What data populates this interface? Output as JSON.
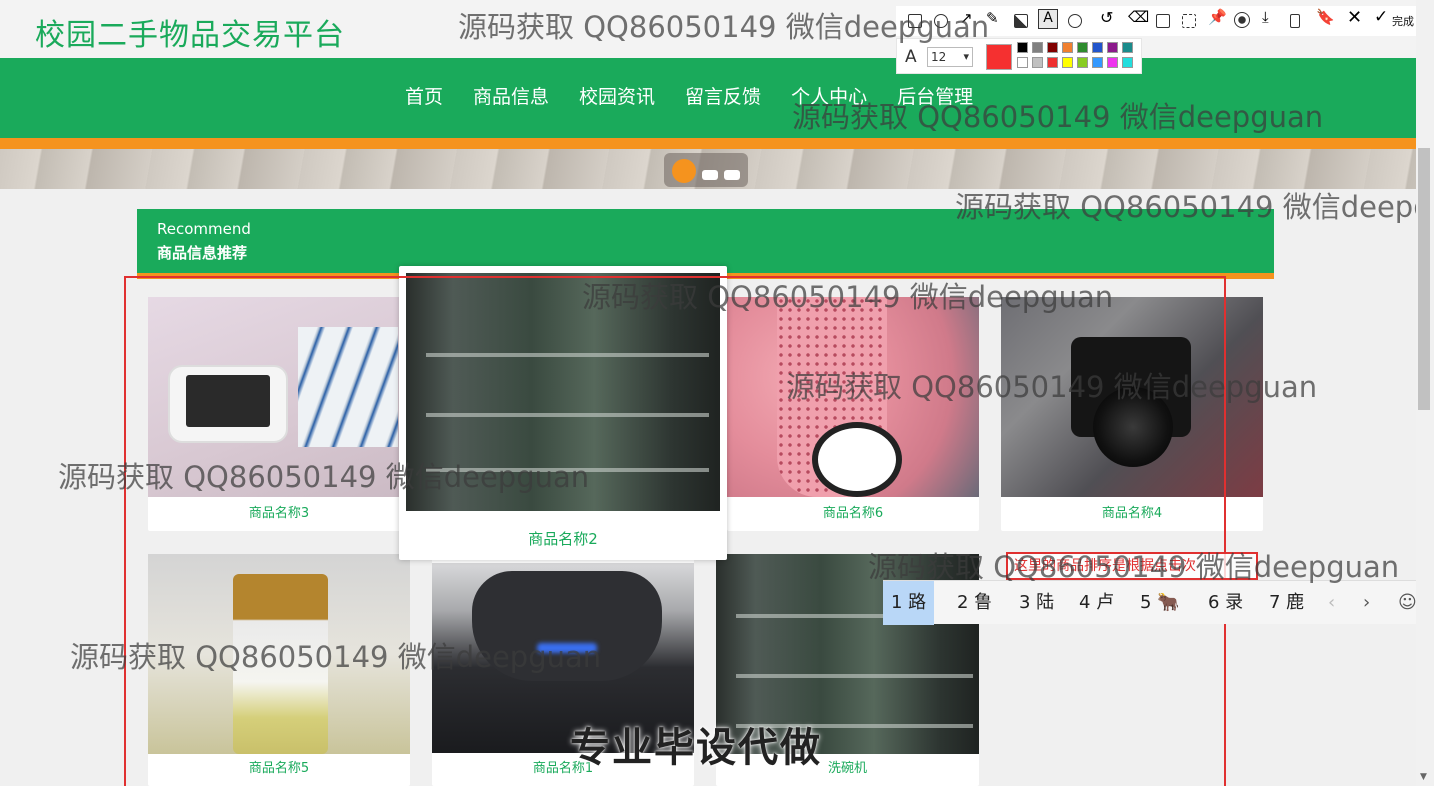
{
  "site": {
    "title": "校园二手物品交易平台"
  },
  "nav": {
    "items": [
      "首页",
      "商品信息",
      "校园资讯",
      "留言反馈",
      "个人中心",
      "后台管理"
    ]
  },
  "recommend": {
    "en": "Recommend",
    "cn": "商品信息推荐"
  },
  "products": [
    {
      "name": "商品名称3"
    },
    {
      "name": "商品名称2"
    },
    {
      "name": "商品名称6"
    },
    {
      "name": "商品名称4"
    },
    {
      "name": "商品名称5"
    },
    {
      "name": "商品名称1"
    },
    {
      "name": "洗碗机"
    }
  ],
  "annotation": {
    "text": "这里的商品排序是根据点击次"
  },
  "toolbar": {
    "done_label": "完成",
    "font_size": "12",
    "current_color": "#f53030",
    "swatches": [
      "#000000",
      "#808080",
      "#800000",
      "#f08030",
      "#2e8b2e",
      "#2255cc",
      "#8b1a8b",
      "#1a8b8b",
      "#ffffff",
      "#c0c0c0",
      "#ee3030",
      "#ffff00",
      "#88cc22",
      "#3399ff",
      "#ee33ee",
      "#22dddd"
    ]
  },
  "ime": {
    "candidates": [
      "1 路",
      "2 鲁",
      "3 陆",
      "4 卢",
      "5 🐂",
      "6 录",
      "7 鹿"
    ]
  },
  "watermarks": {
    "text": "源码获取 QQ86050149 微信deepguan",
    "banner": "专业毕设代做"
  },
  "icons": {
    "toolbar": [
      "rectangle-icon",
      "ellipse-icon",
      "arrow-icon",
      "pen-icon",
      "mosaic-icon",
      "text-icon",
      "number-icon",
      "undo-icon",
      "delete-icon",
      "ocr-icon",
      "crop-icon",
      "pin-icon",
      "record-icon",
      "download-icon",
      "phone-icon",
      "bookmark-icon",
      "close-icon",
      "check-icon"
    ]
  }
}
